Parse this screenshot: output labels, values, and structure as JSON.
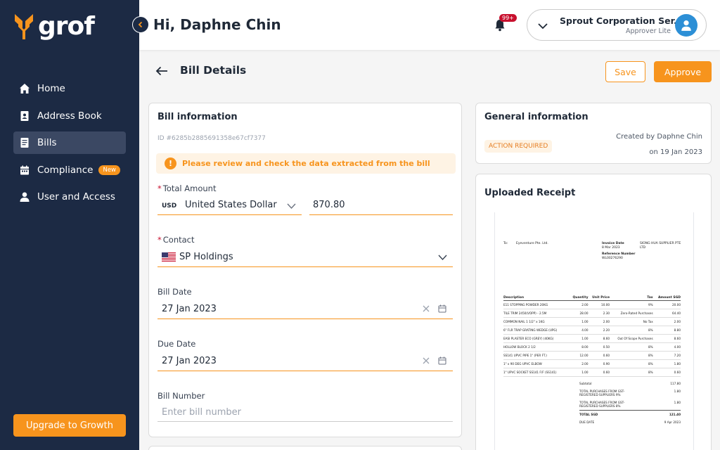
{
  "brand": {
    "name": "grof",
    "accent": "#f7941d",
    "sidebar_bg": "#1c2a44"
  },
  "sidebar": {
    "items": [
      {
        "label": "Home",
        "icon": "home-icon",
        "active": false
      },
      {
        "label": "Address Book",
        "icon": "address-book-icon",
        "active": false
      },
      {
        "label": "Bills",
        "icon": "bills-icon",
        "active": true
      },
      {
        "label": "Compliance",
        "icon": "calendar-icon",
        "active": false,
        "badge": "New"
      },
      {
        "label": "User and Access",
        "icon": "user-icon",
        "active": false
      }
    ],
    "upgrade_label": "Upgrade to Growth"
  },
  "header": {
    "greeting": "Hi, Daphne Chin",
    "notifications": "99+",
    "org_name": "Sprout Corporation Ser..",
    "org_role": "Approver Lite"
  },
  "page": {
    "title": "Bill Details",
    "save_label": "Save",
    "approve_label": "Approve"
  },
  "bill_info": {
    "title": "Bill information",
    "id": "ID #6285b2885691358e67cf7377",
    "warning": "Please review and check the data extracted from the bill",
    "total_amount_label": "Total Amount",
    "currency_code": "USD",
    "currency_name": "United States Dollar",
    "amount": "870.80",
    "contact_label": "Contact",
    "contact": "SP Holdings",
    "bill_date_label": "Bill Date",
    "bill_date": "27 Jan 2023",
    "due_date_label": "Due Date",
    "due_date": "27 Jan 2023",
    "bill_number_label": "Bill Number",
    "bill_number_placeholder": "Enter bill number"
  },
  "general_info": {
    "title": "General information",
    "status": "ACTION REQUIRED",
    "created_by": "Created by Daphne Chin",
    "created_on": "on 19 Jan 2023"
  },
  "receipt": {
    "title": "Uploaded Receipt",
    "to_label": "To:",
    "to_value": "Eyeventure Pte. Ltd.",
    "invoice_date_label": "Invoice Date",
    "invoice_date": "8 Mar 2023",
    "reference_label": "Reference Number",
    "reference": "WL00276290",
    "supplier": "SIONG HUA SUPPLIER PTE LTD",
    "columns": [
      "Description",
      "Quantity",
      "Unit Price",
      "Tax",
      "Amount SGD"
    ],
    "rows": [
      [
        "E11 STOPPING POWDER 20KG",
        "2.00",
        "10.00",
        "9%",
        "20.00"
      ],
      [
        "TILE TRIM 2450(VOPP) - 2.5M",
        "28.00",
        "2.30",
        "Zero-Rated Purchases",
        "64.40"
      ],
      [
        "COMMON NAIL 1 1/2\" x 1KG",
        "1.00",
        "2.00",
        "No Tax",
        "2.00"
      ],
      [
        "6\" FLR TRAP GRATING WEDGE (UPG)",
        "4.00",
        "2.20",
        "8%",
        "8.80"
      ],
      [
        "EASI PLASTER ECO (GREY) (40KG)",
        "1.00",
        "8.60",
        "Out Of Scope Purchases",
        "8.60"
      ],
      [
        "HOLLOW BLOCK 2 1/2",
        "8.00",
        "0.50",
        "8%",
        "4.00"
      ],
      [
        "SS141 UPVC PIPE 1\" (PER FT.)",
        "12.00",
        "0.60",
        "8%",
        "7.20"
      ],
      [
        "1\" x 90 DEG UPVC ELBOW",
        "2.00",
        "0.90",
        "8%",
        "1.80"
      ],
      [
        "1\" UPVC SOCKET SS141 F/F (SS141)",
        "1.00",
        "0.60",
        "8%",
        "0.60"
      ]
    ],
    "subtotal_label": "Subtotal",
    "subtotal": "117.80",
    "gst1_label": "TOTAL PURCHASES FROM GST-REGISTERED SUPPLIERS 9%",
    "gst1": "1.80",
    "gst2_label": "TOTAL PURCHASES FROM GST-REGISTERED SUPPLIERS 8%",
    "gst2": "1.80",
    "total_label": "TOTAL SGD",
    "total": "121.40",
    "due_label": "DUE DATE",
    "due": "9 Apr 2023"
  }
}
